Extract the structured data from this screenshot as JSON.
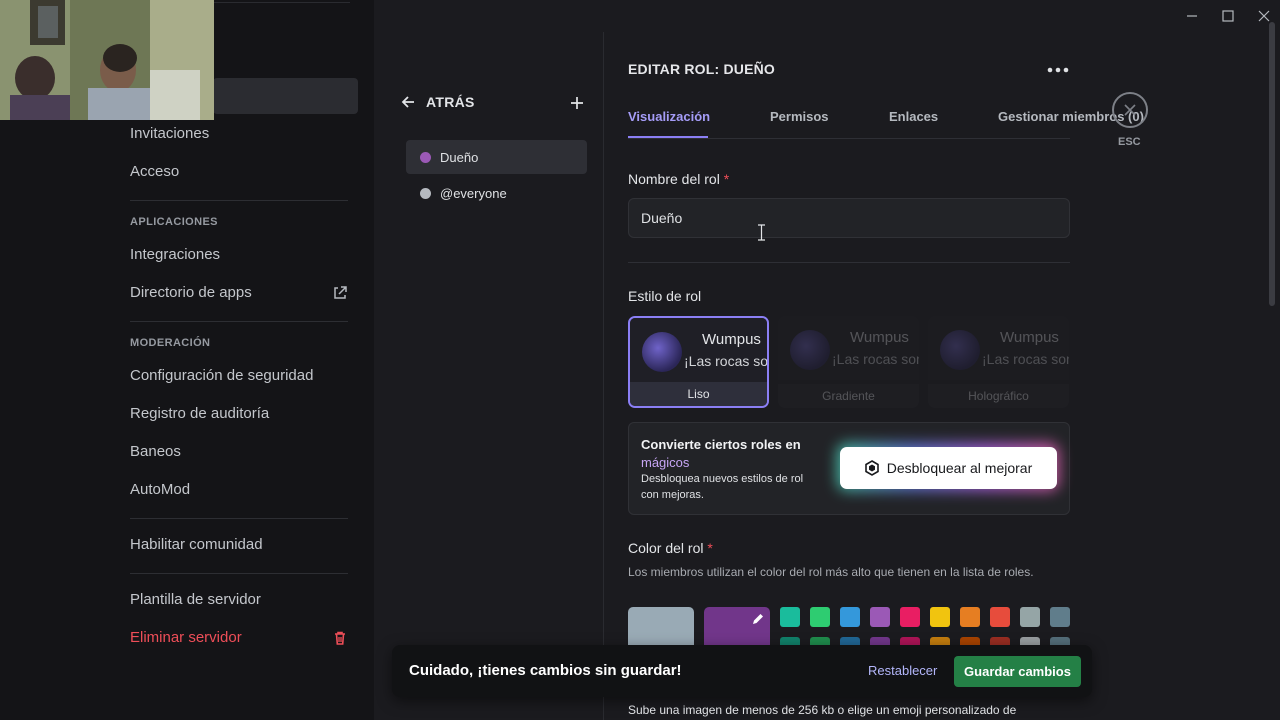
{
  "sidebar": {
    "items": [
      {
        "label": "Invitaciones"
      },
      {
        "label": "Acceso"
      },
      {
        "label": "Integraciones"
      },
      {
        "label": "Directorio de apps"
      },
      {
        "label": "Configuración de seguridad"
      },
      {
        "label": "Registro de auditoría"
      },
      {
        "label": "Baneos"
      },
      {
        "label": "AutoMod"
      },
      {
        "label": "Habilitar comunidad"
      },
      {
        "label": "Plantilla de servidor"
      },
      {
        "label": "Eliminar servidor"
      }
    ],
    "sections": {
      "apps": "APLICACIONES",
      "moderation": "MODERACIÓN"
    }
  },
  "roles": {
    "back_label": "ATRÁS",
    "list": [
      {
        "name": "Dueño",
        "color": "#9b59b6"
      },
      {
        "name": "@everyone",
        "color": "#b5b9bf"
      }
    ]
  },
  "editor": {
    "title": "EDITAR ROL: DUEÑO",
    "tabs": [
      {
        "label": "Visualización"
      },
      {
        "label": "Permisos"
      },
      {
        "label": "Enlaces"
      },
      {
        "label": "Gestionar miembros (0)"
      }
    ],
    "esc_label": "ESC",
    "name_label": "Nombre del rol",
    "required_mark": "*",
    "name_value": "Dueño",
    "style_label": "Estilo de rol",
    "style_options": [
      {
        "label": "Liso",
        "preview_name": "Wumpus",
        "preview_msg": "¡Las rocas son m"
      },
      {
        "label": "Gradiente",
        "preview_name": "Wumpus",
        "preview_msg": "¡Las rocas son m"
      },
      {
        "label": "Holográfico",
        "preview_name": "Wumpus",
        "preview_msg": "¡Las rocas son m"
      }
    ],
    "promo": {
      "title": "Convierte ciertos roles en",
      "title_magic": "mágicos",
      "subtitle": "Desbloquea nuevos estilos de rol con mejoras.",
      "button": "Desbloquear al mejorar"
    },
    "color_label": "Color del rol",
    "color_desc": "Los miembros utilizan el color del rol más alto que tienen en la lista de roles.",
    "colors": {
      "default": "#99aab5",
      "custom": "#71368a",
      "row1": [
        "#1abc9c",
        "#2ecc71",
        "#3498db",
        "#9b59b6",
        "#e91e63",
        "#f1c40f",
        "#e67e22",
        "#e74c3c",
        "#95a5a6",
        "#607d8b"
      ],
      "row2": [
        "#11806a",
        "#1f8b4c",
        "#206694",
        "#71368a",
        "#ad1457",
        "#c27c0e",
        "#a84300",
        "#992d22",
        "#979c9f",
        "#546e7a"
      ]
    },
    "footer_hint": "Sube una imagen de menos de 256 kb o elige un emoji personalizado de"
  },
  "unsaved_bar": {
    "message": "Cuidado, ¡tienes cambios sin guardar!",
    "reset": "Restablecer",
    "save": "Guardar cambios"
  }
}
